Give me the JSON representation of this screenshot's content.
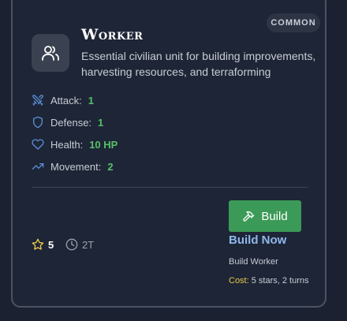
{
  "badge": "COMMON",
  "unit": {
    "name": "Worker",
    "description": "Essential civilian unit for building improvements, harvesting resources, and terraforming",
    "icon": "users-icon"
  },
  "stats": [
    {
      "label": "Attack:",
      "value": "1",
      "icon": "swords-icon"
    },
    {
      "label": "Defense:",
      "value": "1",
      "icon": "shield-icon"
    },
    {
      "label": "Health:",
      "value": "10 HP",
      "icon": "heart-icon"
    },
    {
      "label": "Movement:",
      "value": "2",
      "icon": "trending-up-icon"
    }
  ],
  "footer": {
    "stars": "5",
    "turns": "2T"
  },
  "action": {
    "button_label": "Build",
    "link_label": "Build Now",
    "subtitle": "Build Worker",
    "cost_label": "Cost:",
    "cost_value": "5 stars, 2 turns"
  },
  "colors": {
    "accent_green": "#3b9a57",
    "stat_value": "#56c06a",
    "link": "#8fb8ec",
    "star": "#e9c84a"
  }
}
